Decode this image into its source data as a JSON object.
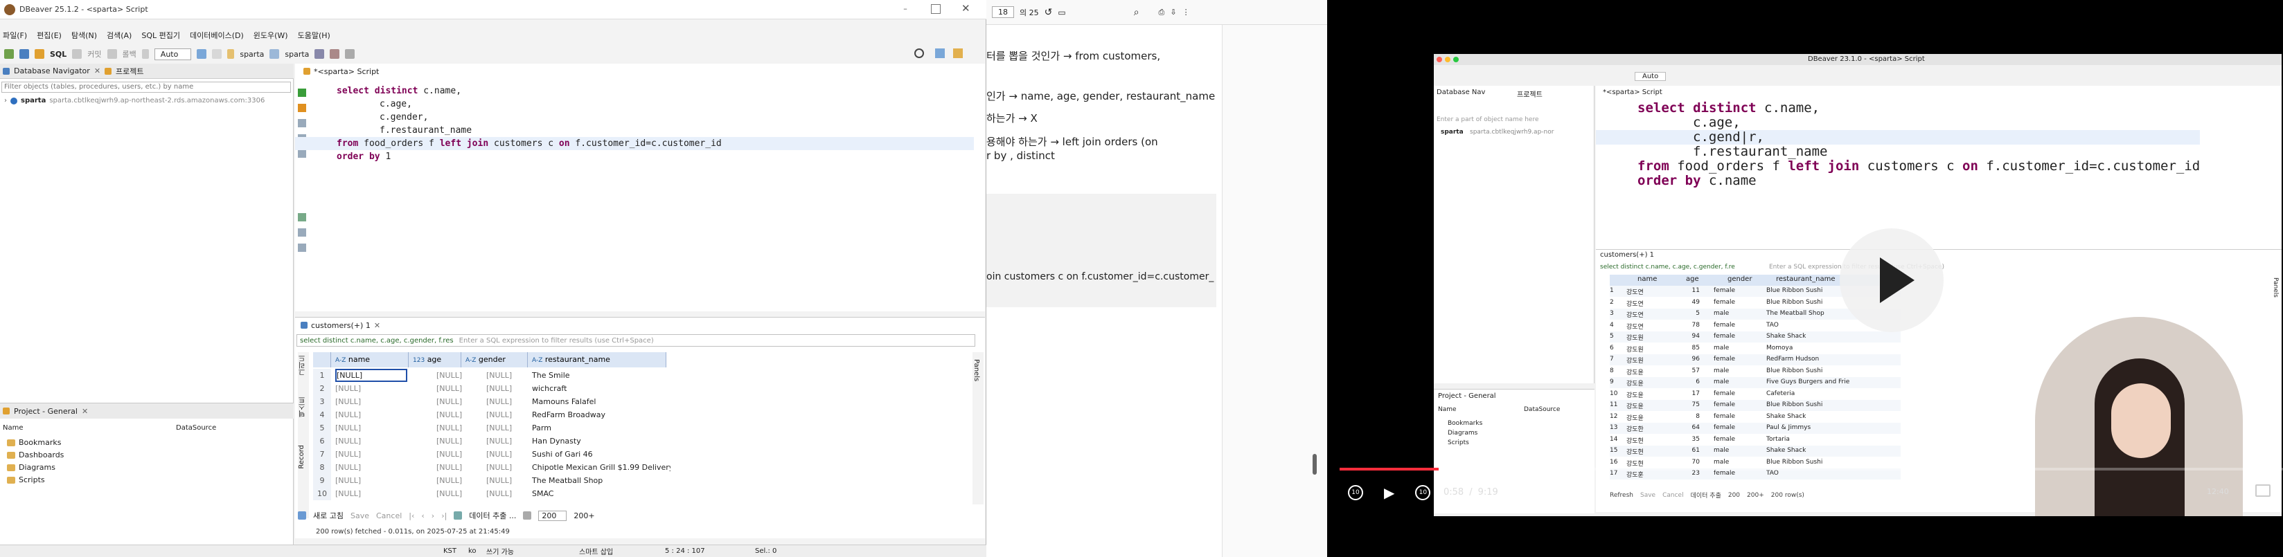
{
  "left_window": {
    "title": "DBeaver 25.1.2 - <sparta> Script",
    "menu": [
      "파일(F)",
      "편집(E)",
      "탐색(N)",
      "검색(A)",
      "SQL 편집기",
      "데이터베이스(D)",
      "윈도우(W)",
      "도움말(H)"
    ],
    "toolbar": {
      "sql_label": "SQL",
      "commit_label": "커밋",
      "rollback_label": "롤백",
      "auto_label": "Auto",
      "connection": "sparta",
      "schema": "sparta"
    },
    "navigator": {
      "tab1": "Database Navigator",
      "tab2": "프로젝트",
      "filter_placeholder": "Filter objects (tables, procedures, users, etc.) by name",
      "conn_name": "sparta",
      "conn_host": "sparta.cbtlkeqjwrh9.ap-northeast-2.rds.amazonaws.com:3306"
    },
    "project": {
      "tab": "Project - General",
      "col_name": "Name",
      "col_ds": "DataSource",
      "items": [
        "Bookmarks",
        "Dashboards",
        "Diagrams",
        "Scripts"
      ]
    },
    "editor": {
      "tab": "*<sparta> Script",
      "lines": [
        {
          "kw": "select distinct",
          "rest": " c.name,"
        },
        {
          "kw": "",
          "rest": "c.age,"
        },
        {
          "kw": "",
          "rest": "c.gender,"
        },
        {
          "kw": "",
          "rest": "f.restaurant_name"
        },
        {
          "kw": "from",
          "rest": " food_orders f ",
          "kw2": "left join",
          "rest2": " customers c ",
          "kw3": "on",
          "rest3": " f.customer_id=c.customer_id"
        },
        {
          "kw": "order by",
          "rest": " 1"
        }
      ]
    },
    "results": {
      "tab": "customers(+) 1",
      "filter_sql": "select distinct c.name, c.age, c.gender, f.res",
      "filter_placeholder": "Enter a SQL expression to filter results (use Ctrl+Space)",
      "columns": [
        "name",
        "age",
        "gender",
        "restaurant_name"
      ],
      "col_prefix": [
        "A-Z",
        "123",
        "A-Z",
        "A-Z"
      ],
      "rows": [
        [
          "1",
          "[NULL]",
          "[NULL]",
          "[NULL]",
          "The Smile"
        ],
        [
          "2",
          "[NULL]",
          "[NULL]",
          "[NULL]",
          "wichcraft"
        ],
        [
          "3",
          "[NULL]",
          "[NULL]",
          "[NULL]",
          "Mamouns Falafel"
        ],
        [
          "4",
          "[NULL]",
          "[NULL]",
          "[NULL]",
          "RedFarm Broadway"
        ],
        [
          "5",
          "[NULL]",
          "[NULL]",
          "[NULL]",
          "Parm"
        ],
        [
          "6",
          "[NULL]",
          "[NULL]",
          "[NULL]",
          "Han Dynasty"
        ],
        [
          "7",
          "[NULL]",
          "[NULL]",
          "[NULL]",
          "Sushi of Gari 46"
        ],
        [
          "8",
          "[NULL]",
          "[NULL]",
          "[NULL]",
          "Chipotle Mexican Grill $1.99 Delivery"
        ],
        [
          "9",
          "[NULL]",
          "[NULL]",
          "[NULL]",
          "The Meatball Shop"
        ],
        [
          "10",
          "[NULL]",
          "[NULL]",
          "[NULL]",
          "SMAC"
        ]
      ],
      "side_tabs": [
        "그리드",
        "텍스트",
        "Record"
      ],
      "panels_label": "Panels",
      "bottom": {
        "refresh": "새로 고침",
        "save": "Save",
        "cancel": "Cancel",
        "export": "데이터 추출 ...",
        "limit": "200",
        "count": "200+"
      },
      "status": "200 row(s) fetched - 0.011s, on 2025-07-25 at 21:45:49"
    },
    "statusbar": {
      "kst": "KST",
      "lang": "ko",
      "mode": "쓰기 가능",
      "insert": "스마트 삽입",
      "pos": "5 : 24 : 107",
      "sel": "Sel.: 0"
    }
  },
  "pdf": {
    "page": "18",
    "of": "의 25",
    "lines": [
      "터를 뽑을 것인가 → from customers,",
      "인가 → name, age, gender, restaurant_name",
      "하는가 → X",
      "용해야 하는가 → left join orders (on",
      "r by , distinct",
      "oin customers c on f.customer_id=c.customer_"
    ]
  },
  "video": {
    "title": "DBeaver 23.1.0 - <sparta> Script",
    "time": "0:58",
    "duration": "9:19",
    "progress": 0.105,
    "editor_tab": "*<sparta> Script",
    "nav_tab1": "Database Nav",
    "nav_tab2": "프로젝트",
    "nav_filter": "Enter a part of object name here",
    "conn": "sparta",
    "conn_host": "sparta.cbtlkeqjwrh9.ap-nor",
    "auto": "Auto",
    "lines": [
      {
        "kw": "select distinct",
        "rest": " c.name,"
      },
      {
        "kw": "",
        "rest": "c.age,"
      },
      {
        "kw": "",
        "rest": "c.gend|r,"
      },
      {
        "kw": "",
        "rest": "f.restaurant_name"
      },
      {
        "kw": "from",
        "rest": " food_orders f ",
        "kw2": "left join",
        "rest2": " customers c ",
        "kw3": "on",
        "rest3": " f.customer_id=c.customer_id"
      },
      {
        "kw": "order by",
        "rest": " c.name"
      }
    ],
    "results_tab": "customers(+) 1",
    "filter_sql": "select distinct c.name, c.age, c.gender, f.re",
    "filter_placeholder": "Enter a SQL expression to filter results (use Ctrl+Space)",
    "columns": [
      "name",
      "age",
      "gender",
      "restaurant_name"
    ],
    "rows": [
      [
        "1",
        "강도연",
        "11",
        "female",
        "Blue Ribbon Sushi"
      ],
      [
        "2",
        "강도연",
        "49",
        "female",
        "Blue Ribbon Sushi"
      ],
      [
        "3",
        "강도연",
        "5",
        "male",
        "The Meatball Shop"
      ],
      [
        "4",
        "강도연",
        "78",
        "female",
        "TAO"
      ],
      [
        "5",
        "강도원",
        "94",
        "female",
        "Shake Shack"
      ],
      [
        "6",
        "강도원",
        "85",
        "male",
        "Momoya"
      ],
      [
        "7",
        "강도원",
        "96",
        "female",
        "RedFarm Hudson"
      ],
      [
        "8",
        "강도윤",
        "57",
        "male",
        "Blue Ribbon Sushi"
      ],
      [
        "9",
        "강도윤",
        "6",
        "male",
        "Five Guys Burgers and Frie"
      ],
      [
        "10",
        "강도윤",
        "17",
        "female",
        "Cafeteria"
      ],
      [
        "11",
        "강도윤",
        "75",
        "female",
        "Blue Ribbon Sushi"
      ],
      [
        "12",
        "강도윤",
        "8",
        "female",
        "Shake Shack"
      ],
      [
        "13",
        "강도한",
        "64",
        "female",
        "Paul & Jimmys"
      ],
      [
        "14",
        "강도현",
        "35",
        "female",
        "Tortaria"
      ],
      [
        "15",
        "강도현",
        "61",
        "male",
        "Shake Shack"
      ],
      [
        "16",
        "강도현",
        "70",
        "male",
        "Blue Ribbon Sushi"
      ],
      [
        "17",
        "강도훈",
        "23",
        "female",
        "TAO"
      ]
    ],
    "project_tab": "Project - General",
    "project_items": [
      "Bookmarks",
      "Diagrams",
      "Scripts"
    ],
    "col_name": "Name",
    "col_ds": "DataSource",
    "bottom": {
      "refresh": "Refresh",
      "save": "Save",
      "cancel": "Cancel",
      "export": "데이터 추출",
      "limit": "200",
      "count": "200+",
      "rows": "200 row(s)"
    },
    "side_label": "Panels",
    "clock": "12:40"
  }
}
